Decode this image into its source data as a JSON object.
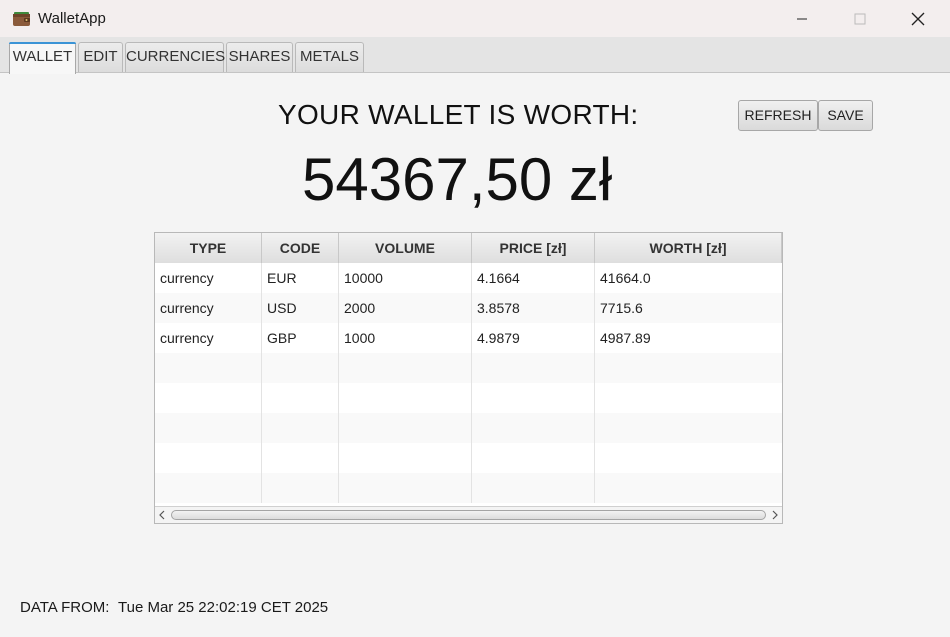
{
  "window": {
    "title": "WalletApp",
    "icons": {
      "app": "wallet-icon",
      "minimize": "minimize-icon",
      "maximize": "maximize-icon",
      "close": "close-icon"
    }
  },
  "tabs": [
    {
      "label": "WALLET",
      "active": true
    },
    {
      "label": "EDIT",
      "active": false
    },
    {
      "label": "CURRENCIES",
      "active": false
    },
    {
      "label": "SHARES",
      "active": false
    },
    {
      "label": "METALS",
      "active": false
    }
  ],
  "main": {
    "heading": "YOUR WALLET IS WORTH:",
    "amount": "54367,50 zł",
    "refresh_label": "REFRESH",
    "save_label": "SAVE"
  },
  "table": {
    "columns": [
      "TYPE",
      "CODE",
      "VOLUME",
      "PRICE [zł]",
      "WORTH [zł]"
    ],
    "rows": [
      [
        "currency",
        "EUR",
        "10000",
        "4.1664",
        "41664.0"
      ],
      [
        "currency",
        "USD",
        "2000",
        "3.8578",
        "7715.6"
      ],
      [
        "currency",
        "GBP",
        "1000",
        "4.9879",
        "4987.89"
      ]
    ]
  },
  "footer": {
    "label": "DATA FROM:",
    "value": "Tue Mar 25 22:02:19 CET 2025"
  },
  "colors": {
    "accent": "#3a94d6",
    "background": "#f4f4f4"
  }
}
